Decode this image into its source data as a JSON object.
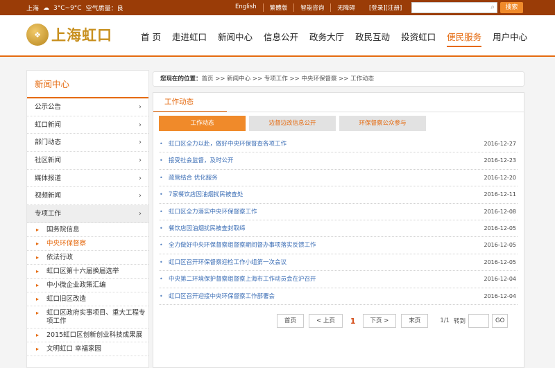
{
  "topbar": {
    "city": "上海",
    "weather_icon": "cloud-icon",
    "temperature": "3°C~9°C",
    "air_quality": "空气质量：良",
    "links": [
      "English",
      "繁體版",
      "智能咨询",
      "无障碍"
    ],
    "login": "[登录][注册]",
    "search_placeholder": "",
    "search_button": "搜索"
  },
  "header": {
    "logo_text": "上海虹口",
    "nav": [
      "首 页",
      "走进虹口",
      "新闻中心",
      "信息公开",
      "政务大厅",
      "政民互动",
      "投资虹口",
      "便民服务",
      "用户中心"
    ],
    "active_nav_index": 7,
    "accent_color": "#e56a0f"
  },
  "sidebar": {
    "title": "新闻中心",
    "items": [
      "公示公告",
      "虹口新闻",
      "部门动态",
      "社区新闻",
      "媒体报道",
      "视频新闻",
      "专项工作"
    ],
    "selected_index": 6,
    "sub_items": [
      "国务院信息",
      "中央环保督察",
      "依法行政",
      "虹口区第十六届换届选举",
      "中小微企业政策汇编",
      "虹口旧区改造",
      "虹口区政府实事项目、重大工程专项工作",
      "2015虹口区创新创业科技成果展",
      "文明虹口 幸福家园"
    ],
    "current_sub_index": 1
  },
  "breadcrumb": {
    "label": "您现在的位置：",
    "path": "首页 >> 新闻中心 >> 专项工作 >> 中央环保督察 >> 工作动态"
  },
  "panel": {
    "title": "工作动态",
    "tabs": [
      "工作动态",
      "边督边改信息公开",
      "环保督察公众参与"
    ],
    "active_tab": 0,
    "articles": [
      {
        "title": "虹口区全力以赴，做好中央环保督查各项工作",
        "date": "2016-12-27"
      },
      {
        "title": "接受社会监督，及时公开",
        "date": "2016-12-23"
      },
      {
        "title": "疏管结合 优化服务",
        "date": "2016-12-20"
      },
      {
        "title": "7家餐饮店因油烟扰民被查处",
        "date": "2016-12-11"
      },
      {
        "title": "虹口区全力落实中央环保督察工作",
        "date": "2016-12-08"
      },
      {
        "title": "餐饮店因油烟扰民被查封取缔",
        "date": "2016-12-05"
      },
      {
        "title": "全力做好中央环保督察组督察期间督办事项落实反馈工作",
        "date": "2016-12-05"
      },
      {
        "title": "虹口区召开环保督察迎检工作小组第一次会议",
        "date": "2016-12-05"
      },
      {
        "title": "中央第二环境保护督察组督察上海市工作动员会在沪召开",
        "date": "2016-12-04"
      },
      {
        "title": "虹口区召开迎接中央环保督察工作部署会",
        "date": "2016-12-04"
      }
    ]
  },
  "pager": {
    "first": "首页",
    "prev": "< 上页",
    "current": "1",
    "next": "下页 >",
    "last": "末页",
    "info": "1/1",
    "goto_label": "转到",
    "go": "GO"
  }
}
